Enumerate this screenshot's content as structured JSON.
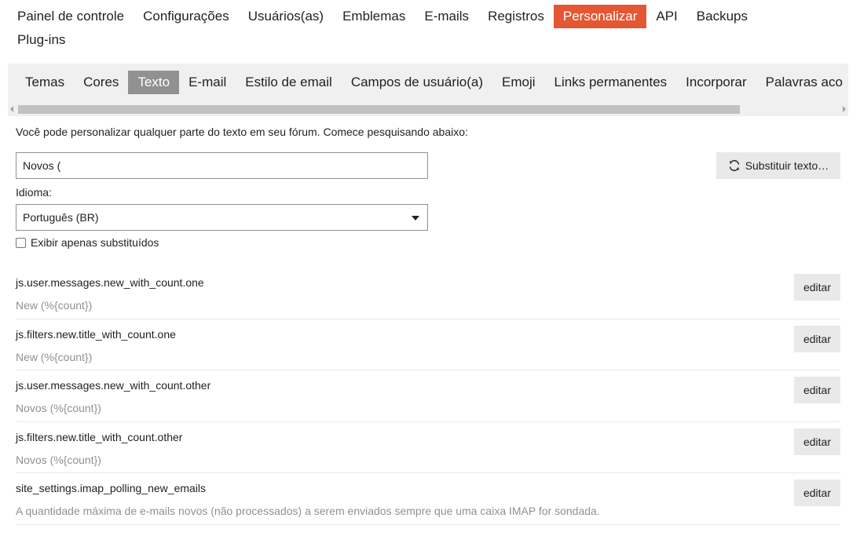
{
  "top_nav": [
    {
      "label": "Painel de controle",
      "active": false
    },
    {
      "label": "Configurações",
      "active": false
    },
    {
      "label": "Usuários(as)",
      "active": false
    },
    {
      "label": "Emblemas",
      "active": false
    },
    {
      "label": "E-mails",
      "active": false
    },
    {
      "label": "Registros",
      "active": false
    },
    {
      "label": "Personalizar",
      "active": true
    },
    {
      "label": "API",
      "active": false
    },
    {
      "label": "Backups",
      "active": false
    },
    {
      "label": "Plug-ins",
      "active": false
    }
  ],
  "sub_nav": [
    {
      "label": "Temas",
      "active": false
    },
    {
      "label": "Cores",
      "active": false
    },
    {
      "label": "Texto",
      "active": true
    },
    {
      "label": "E-mail",
      "active": false
    },
    {
      "label": "Estilo de email",
      "active": false
    },
    {
      "label": "Campos de usuário(a)",
      "active": false
    },
    {
      "label": "Emoji",
      "active": false
    },
    {
      "label": "Links permanentes",
      "active": false
    },
    {
      "label": "Incorporar",
      "active": false
    },
    {
      "label": "Palavras aco",
      "active": false
    }
  ],
  "intro_text": "Você pode personalizar qualquer parte do texto em seu fórum. Comece pesquisando abaixo:",
  "search": {
    "value": "Novos ("
  },
  "replace_button": {
    "label": "Substituir texto…",
    "icon": "refresh-icon"
  },
  "language": {
    "label": "Idioma:",
    "selected": "Português (BR)"
  },
  "only_overridden": {
    "label": "Exibir apenas substituídos",
    "checked": false
  },
  "results": [
    {
      "key": "js.user.messages.new_with_count.one",
      "value": "New (%{count})",
      "edit_label": "editar"
    },
    {
      "key": "js.filters.new.title_with_count.one",
      "value": "New (%{count})",
      "edit_label": "editar"
    },
    {
      "key": "js.user.messages.new_with_count.other",
      "value": "Novos (%{count})",
      "edit_label": "editar"
    },
    {
      "key": "js.filters.new.title_with_count.other",
      "value": "Novos (%{count})",
      "edit_label": "editar"
    },
    {
      "key": "site_settings.imap_polling_new_emails",
      "value": "A quantidade máxima de e-mails novos (não processados) a serem enviados sempre que uma caixa IMAP for sondada.",
      "edit_label": "editar"
    }
  ],
  "colors": {
    "accent": "#e45735",
    "active_subtab": "#919191",
    "muted_text": "#919191",
    "button_bg": "#e9e9e9"
  }
}
